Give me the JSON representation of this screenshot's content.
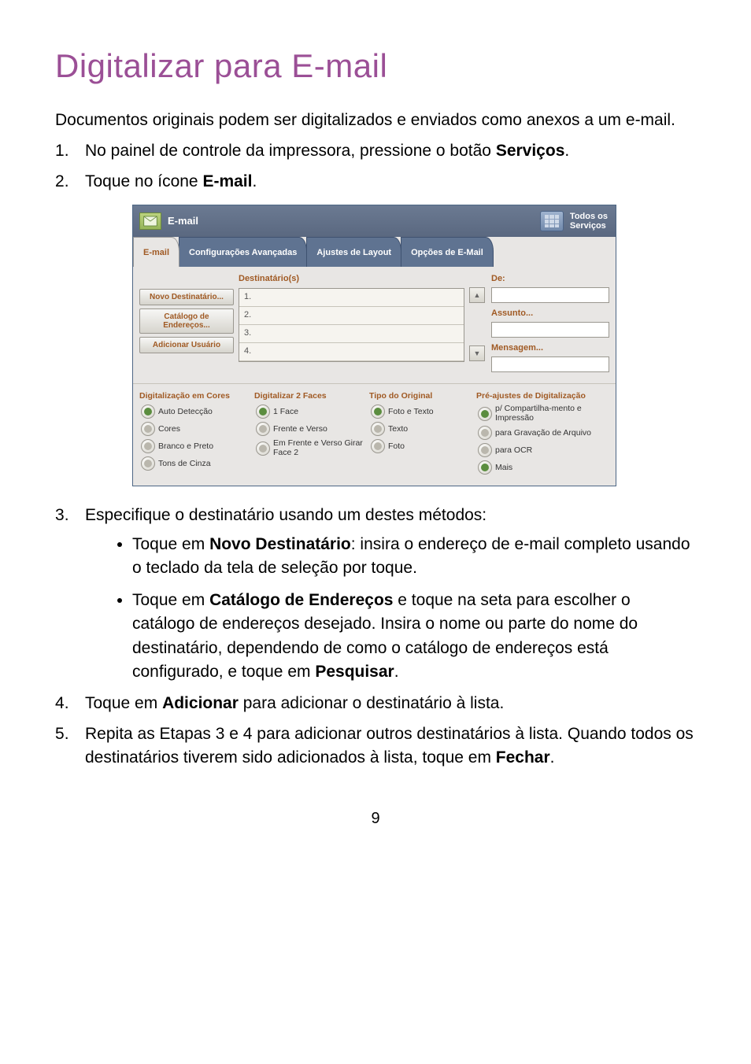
{
  "heading": "Digitalizar para E-mail",
  "intro": "Documentos originais podem ser digitalizados e enviados como anexos a um e-mail.",
  "steps": {
    "s1_a": "No painel de controle da impressora, pressione o botão ",
    "s1_b": "Serviços",
    "s1_c": ".",
    "s2_a": "Toque no ícone ",
    "s2_b": "E-mail",
    "s2_c": ".",
    "s3": "Especifique o destinatário usando um destes métodos:",
    "s3_b1_a": "Toque em ",
    "s3_b1_b": "Novo Destinatário",
    "s3_b1_c": ": insira o endereço de e-mail completo usando o teclado da tela de seleção por toque.",
    "s3_b2_a": "Toque em ",
    "s3_b2_b": "Catálogo de Endereços",
    "s3_b2_c": " e toque na seta para escolher o catálogo de endereços desejado. Insira o nome ou parte do nome do destinatário, dependendo de como o catálogo de endereços está configurado, e toque em ",
    "s3_b2_d": "Pesquisar",
    "s3_b2_e": ".",
    "s4_a": "Toque em ",
    "s4_b": "Adicionar",
    "s4_c": " para adicionar o destinatário à lista.",
    "s5_a": "Repita as Etapas 3 e 4 para adicionar outros destinatários à lista. Quando todos os destinatários tiverem sido adicionados à lista, toque em ",
    "s5_b": "Fechar",
    "s5_c": "."
  },
  "ui": {
    "header_title": "E-mail",
    "all_services_l1": "Todos os",
    "all_services_l2": "Serviços",
    "tabs": {
      "t1": "E-mail",
      "t2": "Configurações Avançadas",
      "t3": "Ajustes de Layout",
      "t4": "Opções de E-Mail"
    },
    "recipients_header": "Destinatário(s)",
    "leftbtns": {
      "b1": "Novo Destinatário...",
      "b2": "Catálogo de Endereços...",
      "b3": "Adicionar Usuário"
    },
    "rows": {
      "r1": "1.",
      "r2": "2.",
      "r3": "3.",
      "r4": "4."
    },
    "fields": {
      "from": "De:",
      "subject": "Assunto...",
      "message": "Mensagem..."
    },
    "options": {
      "col1": {
        "h": "Digitalização em Cores",
        "o1": "Auto Detecção",
        "o2": "Cores",
        "o3": "Branco e Preto",
        "o4": "Tons de Cinza"
      },
      "col2": {
        "h": "Digitalizar 2 Faces",
        "o1": "1 Face",
        "o2": "Frente e Verso",
        "o3": "Em Frente e Verso Girar Face 2"
      },
      "col3": {
        "h": "Tipo do Original",
        "o1": "Foto e Texto",
        "o2": "Texto",
        "o3": "Foto"
      },
      "col4": {
        "h": "Pré-ajustes de Digitalização",
        "o1": "p/ Compartilha-mento e Impressão",
        "o2": "para Gravação de Arquivo",
        "o3": "para OCR",
        "o4": "Mais"
      }
    }
  },
  "page_number": "9"
}
